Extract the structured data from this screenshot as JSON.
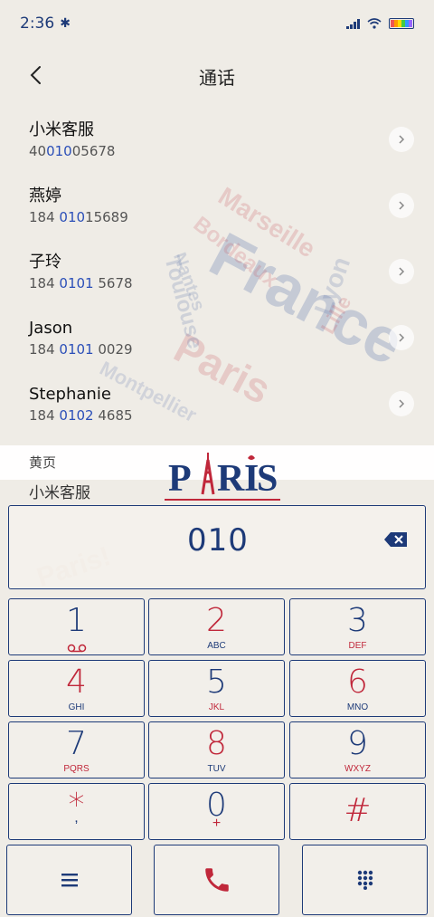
{
  "status": {
    "time": "2:36",
    "bluetooth_icon": "bluetooth-icon"
  },
  "header": {
    "title": "通话",
    "back_icon": "chevron-left-icon"
  },
  "contacts": [
    {
      "name": "小米客服",
      "number_pre": "40",
      "number_hl": "010",
      "number_post": "05678"
    },
    {
      "name": "燕婷",
      "number_pre": "184 ",
      "number_hl": "010",
      "number_post": "15689"
    },
    {
      "name": "子玲",
      "number_pre": "184 ",
      "number_hl": "0101",
      "number_post": " 5678"
    },
    {
      "name": "Jason",
      "number_pre": "184 ",
      "number_hl": "0101",
      "number_post": " 0029"
    },
    {
      "name": "Stephanie",
      "number_pre": "184 ",
      "number_hl": "0102",
      "number_post": " 4685"
    }
  ],
  "yellow_pages": {
    "header": "黄页",
    "peek": "小米客服"
  },
  "logo_text": "PARIS",
  "dialer": {
    "input_value": "010",
    "keys": [
      {
        "digit": "1",
        "letters": "",
        "digit_color": "blue"
      },
      {
        "digit": "2",
        "letters": "ABC",
        "digit_color": "red"
      },
      {
        "digit": "3",
        "letters": "DEF",
        "digit_color": "blue"
      },
      {
        "digit": "4",
        "letters": "GHI",
        "digit_color": "red"
      },
      {
        "digit": "5",
        "letters": "JKL",
        "digit_color": "blue"
      },
      {
        "digit": "6",
        "letters": "MNO",
        "digit_color": "red"
      },
      {
        "digit": "7",
        "letters": "PQRS",
        "digit_color": "blue"
      },
      {
        "digit": "8",
        "letters": "TUV",
        "digit_color": "red"
      },
      {
        "digit": "9",
        "letters": "WXYZ",
        "digit_color": "blue"
      },
      {
        "digit": "*",
        "letters": ",",
        "digit_color": "red"
      },
      {
        "digit": "0",
        "letters": "+",
        "digit_color": "blue"
      },
      {
        "digit": "#",
        "letters": "",
        "digit_color": "red"
      }
    ]
  },
  "colors": {
    "accent_blue": "#1d3a78",
    "accent_red": "#c0273a",
    "highlight": "#2b4fb8"
  }
}
